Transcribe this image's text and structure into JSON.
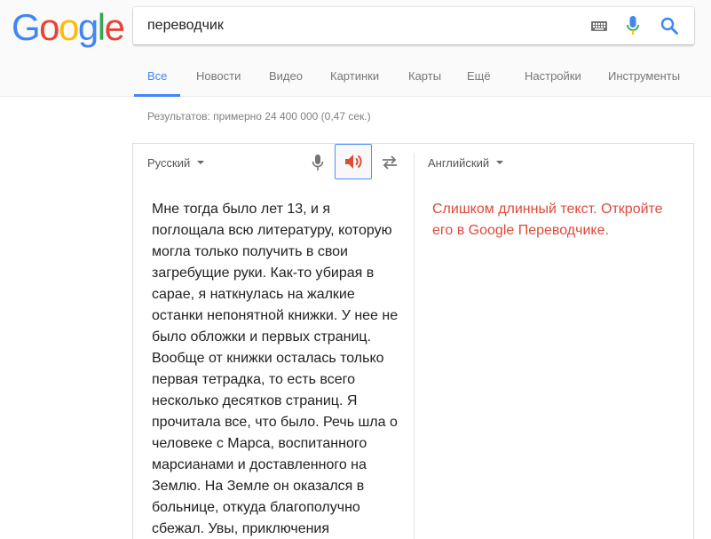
{
  "logo": {
    "text": "Google"
  },
  "search": {
    "query": "переводчик"
  },
  "tabs": [
    {
      "label": "Все"
    },
    {
      "label": "Новости"
    },
    {
      "label": "Видео"
    },
    {
      "label": "Картинки"
    },
    {
      "label": "Карты"
    },
    {
      "label": "Ещё"
    },
    {
      "label": "Настройки"
    },
    {
      "label": "Инструменты"
    }
  ],
  "results_stats": "Результатов: примерно 24 400 000 (0,47 сек.)",
  "translator": {
    "source_lang": "Русский",
    "target_lang": "Английский",
    "source_text": "Мне тогда было лет 13, и я поглощала всю литературу, которую могла только получить в свои загребущие руки. Как-то убирая в сарае, я наткнулась на жалкие останки непонятной книжки. У нее не было обложки и первых страниц. Вообще от книжки осталась только первая тетрадка, то есть всего несколько десятков страниц. Я прочитала все, что было. Речь шла о человеке с Марса, воспитанного марсианами и доставленного на Землю. На Земле он оказался в больнице, откуда благополучно сбежал. Увы, приключения",
    "target_message": "Слишком длинный текст. Откройте его в Google Переводчике."
  },
  "icons": {
    "keyboard": "keyboard-icon",
    "mic": "mic-icon",
    "search": "search-icon",
    "speaker": "speaker-icon",
    "swap": "swap-icon"
  },
  "colors": {
    "blue": "#4285f4",
    "red": "#ea4335",
    "yellow": "#fbbc05",
    "green": "#34a853",
    "error": "#dd4b39"
  }
}
